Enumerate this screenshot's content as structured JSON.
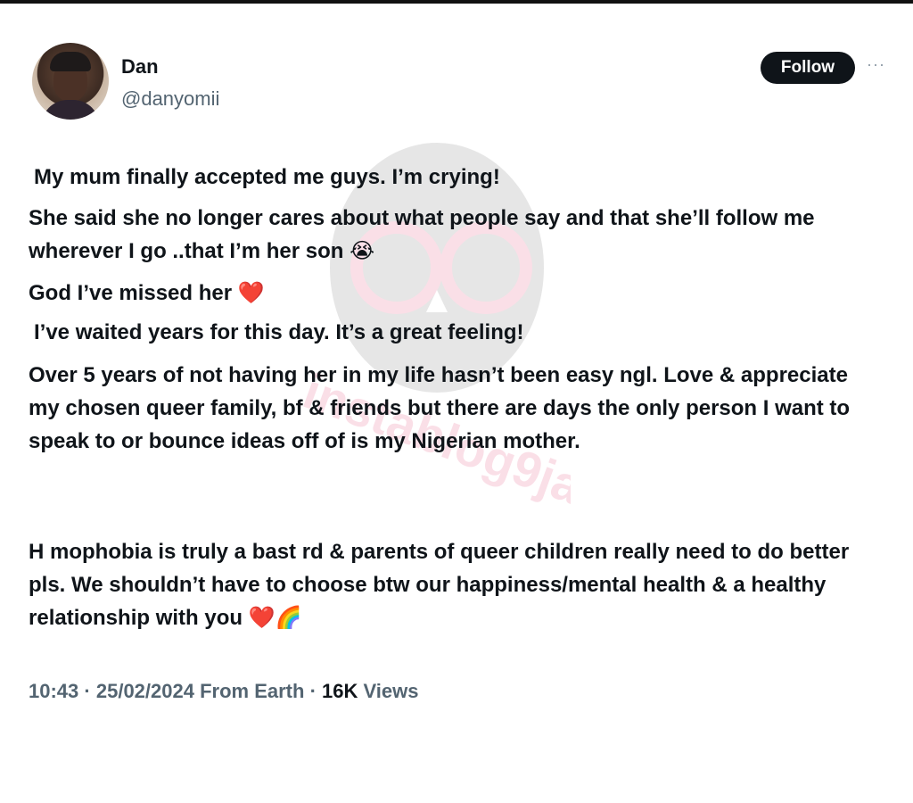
{
  "author": {
    "name": "Dan",
    "handle": "@danyomii",
    "follow_label": "Follow",
    "more_label": "···"
  },
  "post": {
    "line1": "My mum finally accepted me guys. I’m crying!",
    "line2": "She said she no longer cares about what people say and that she’ll follow me wherever I go ..that I’m her son 😭",
    "line3": "God I’ve missed her ❤️",
    "line4": "I’ve waited years for this day. It’s a great feeling!",
    "line5": "Over 5 years of not having her in my life hasn’t been easy ngl. Love & appreciate my chosen queer family, bf & friends but there are days the only person I want to speak to or bounce ideas off of is my Nigerian mother.",
    "line6": "H mophobia is truly a bast rd & parents of queer children really need to do better pls. We shouldn’t have to choose btw our happiness/mental health & a healthy relationship with you ❤️🌈"
  },
  "meta": {
    "time": "10:43",
    "date": "25/02/2024",
    "source": "From Earth",
    "views_count": "16K",
    "views_label": "Views"
  },
  "watermark": {
    "text": "instablog9ja",
    "color": "#e0245e"
  }
}
